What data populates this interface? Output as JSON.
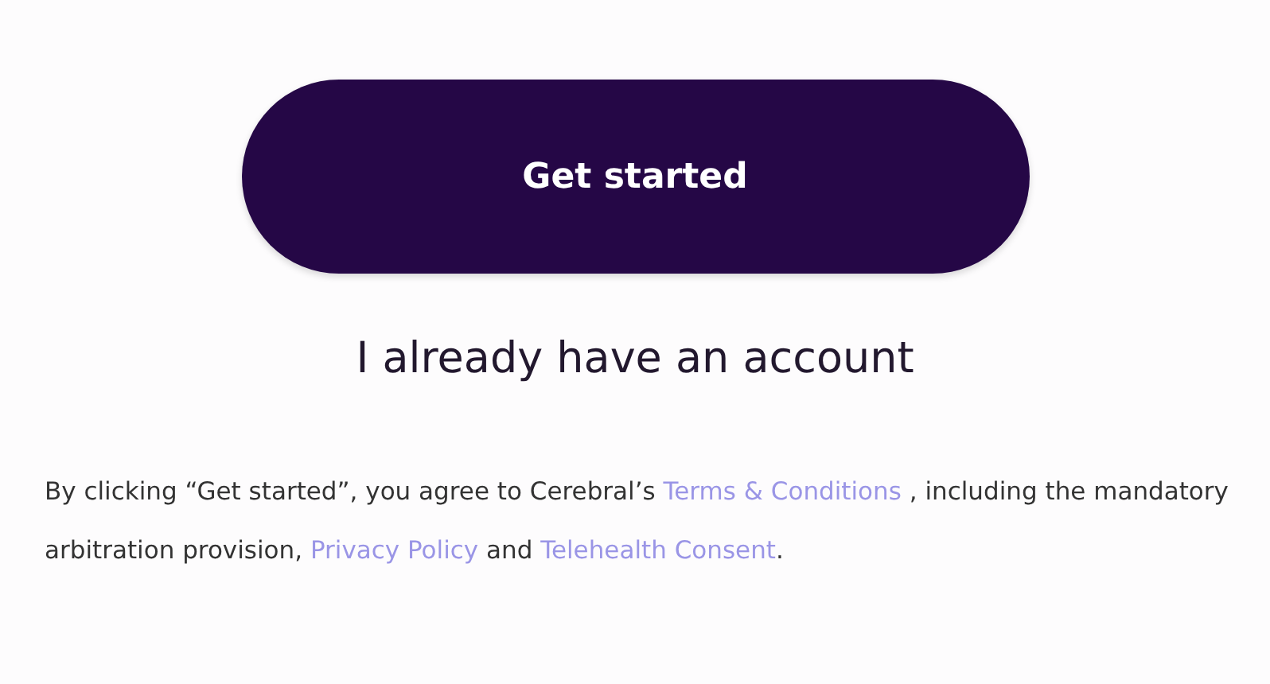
{
  "primary_button": {
    "label": "Get started"
  },
  "secondary_link": {
    "label": "I already have an account"
  },
  "consent": [
    {
      "kind": "text",
      "text": "By clicking “Get started”, you agree to Cerebral’s "
    },
    {
      "kind": "link",
      "text": "Terms & Conditions"
    },
    {
      "kind": "text",
      "text": " , including the mandatory arbitration provision, "
    },
    {
      "kind": "link",
      "text": "Privacy Policy"
    },
    {
      "kind": "text",
      "text": " and "
    },
    {
      "kind": "link",
      "text": "Telehealth Consent"
    },
    {
      "kind": "text",
      "text": "."
    }
  ]
}
